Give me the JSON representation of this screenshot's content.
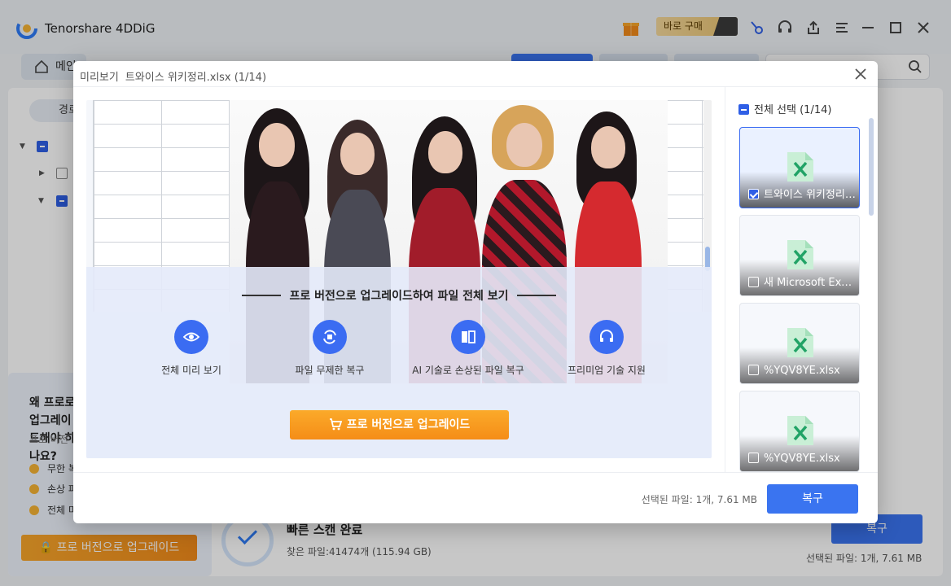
{
  "app": {
    "title": "Tenorshare 4DDiG",
    "buy_label": "바로 구매",
    "home_tab": "메인",
    "path_pill": "경로"
  },
  "left_panel": {
    "why_title": "왜 프로로 업그레이드해야 하나요?",
    "pro_label": "프로 버전",
    "features": [
      "무한 복구",
      "손상 파일 복구",
      "전체 미리 보기"
    ],
    "upgrade_label": "프로 버전으로 업그레이드"
  },
  "scan": {
    "status": "빠른 스캔 완료",
    "found": "찾은 파일:41474개 (115.94 GB)",
    "recover_label": "복구",
    "selected": "선택된 파일: 1개, 7.61 MB"
  },
  "dialog": {
    "title_prefix": "미리보기",
    "file_name": "트와이스 위키정리.xlsx (1/14)",
    "pro_heading": "프로 버전으로 업그레이드하여 파일 전체 보기",
    "features": [
      {
        "icon": "eye-icon",
        "label": "전체 미리 보기"
      },
      {
        "icon": "restore-icon",
        "label": "파일 무제한 복구"
      },
      {
        "icon": "repair-icon",
        "label": "AI 기술로 손상된 파일 복구"
      },
      {
        "icon": "support-icon",
        "label": "프리미엄 기술 지원"
      }
    ],
    "upgrade_label": "프로 버전으로 업그레이드",
    "select_all": "전체 선택 (1/14)",
    "files": [
      {
        "name": "트와이스 위키정리.xlsx",
        "checked": true
      },
      {
        "name": "새 Microsoft Excel 워크시트.xlsx",
        "checked": false
      },
      {
        "name": "%YQV8YE.xlsx",
        "checked": false
      },
      {
        "name": "%YQV8YE.xlsx",
        "checked": false
      }
    ],
    "selected": "선택된 파일: 1개, 7.61 MB",
    "recover_label": "복구"
  },
  "colors": {
    "accent": "#3a74f0",
    "upgrade": "#f58d17",
    "excel_green": "#21a366"
  }
}
